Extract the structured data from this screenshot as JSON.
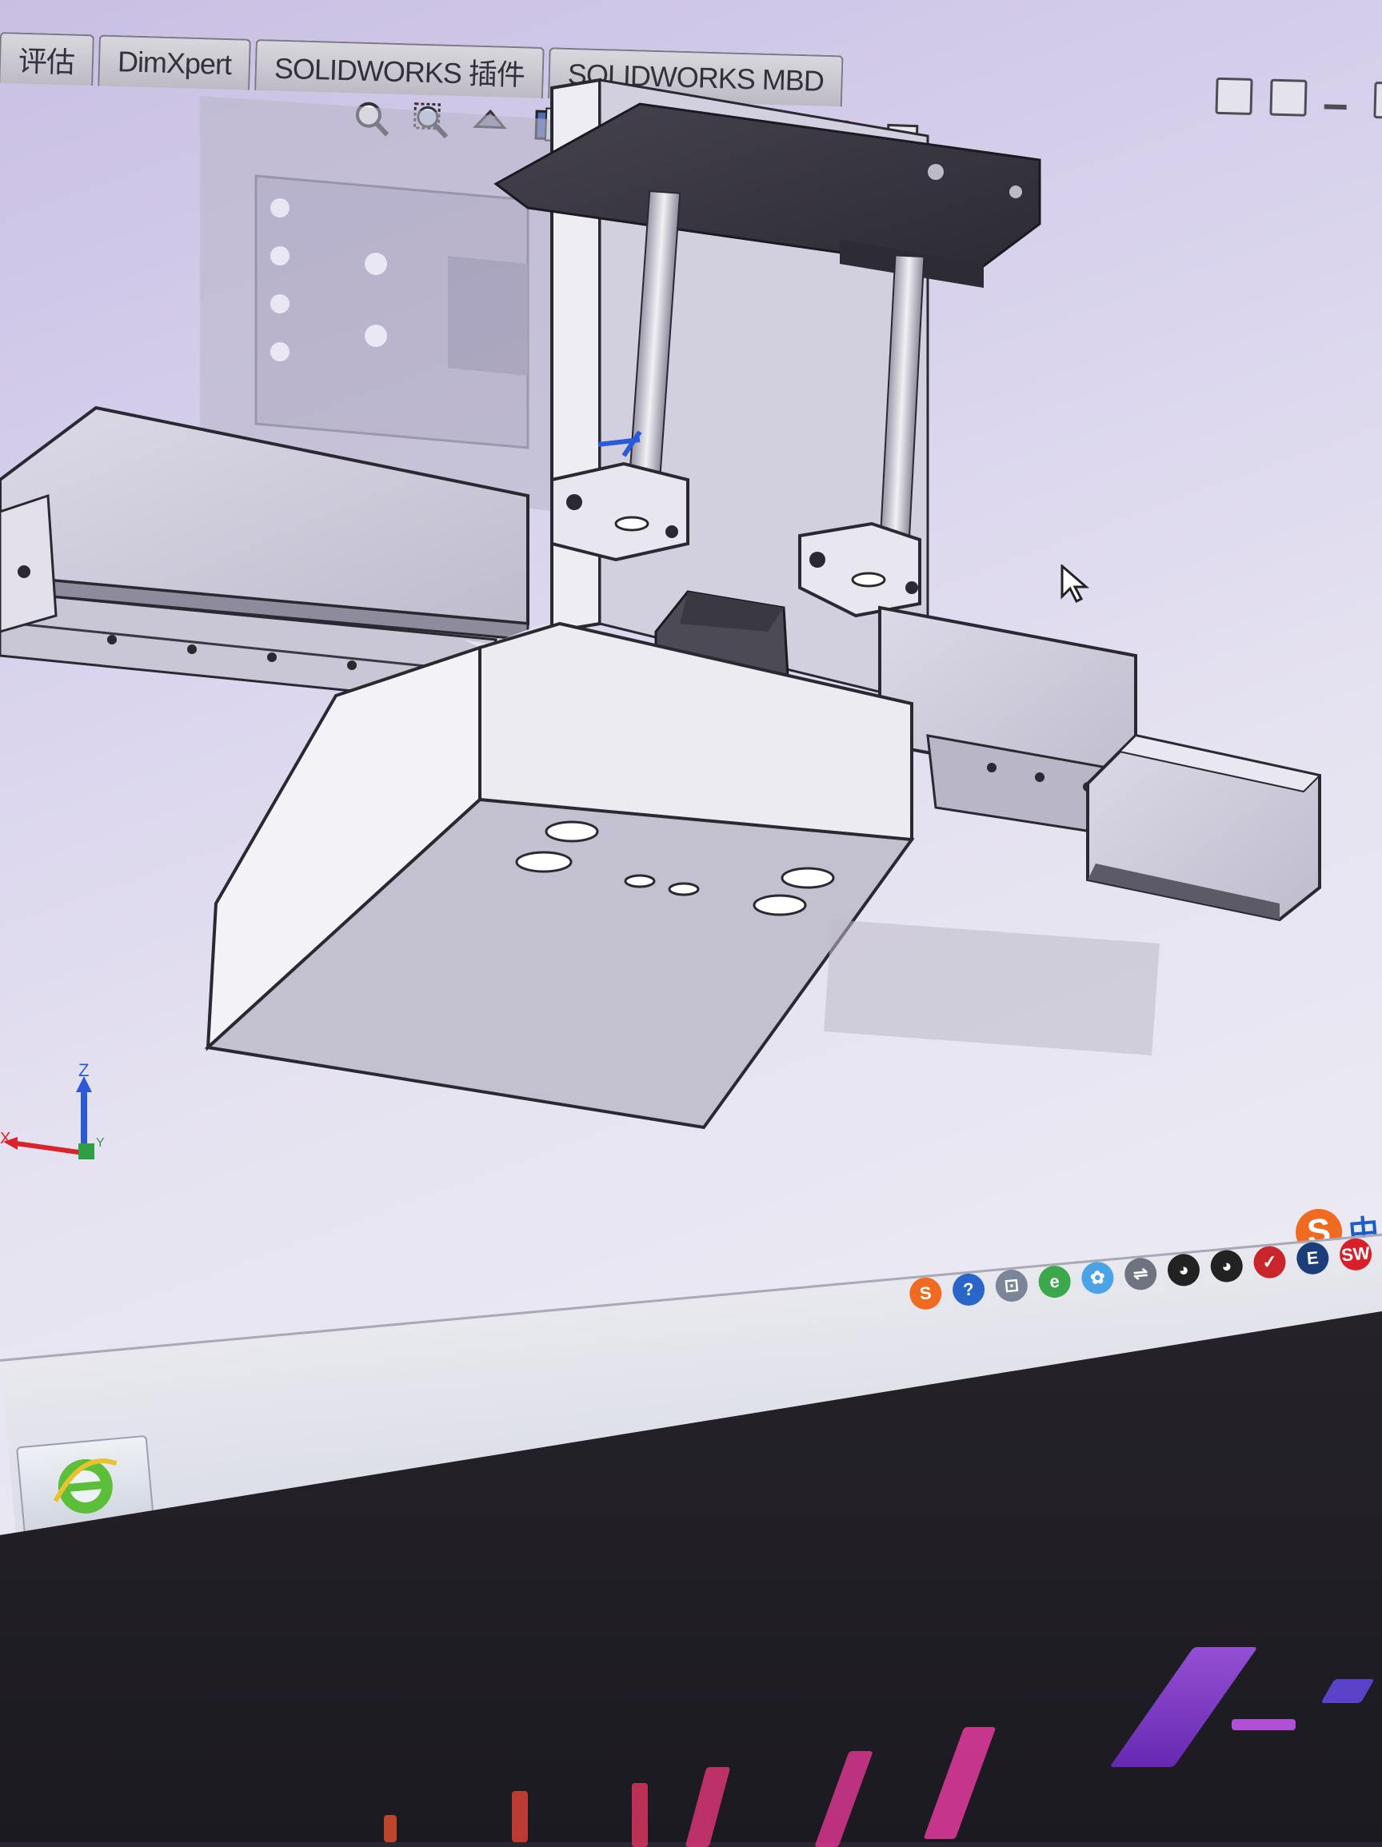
{
  "command_manager": {
    "tabs": [
      {
        "label": "评估"
      },
      {
        "label": "DimXpert"
      },
      {
        "label": "SOLIDWORKS 插件"
      },
      {
        "label": "SOLIDWORKS MBD"
      }
    ]
  },
  "heads_up_toolbar": {
    "icons": [
      "zoom-to-fit-icon",
      "zoom-to-area-icon",
      "previous-view-icon",
      "section-view-icon",
      "view-orientation-icon",
      "display-style-icon",
      "hide-show-items-icon",
      "edit-appearance-icon",
      "apply-scene-icon",
      "view-settings-icon"
    ]
  },
  "window_controls": [
    "restore-pane-icon",
    "split-pane-icon",
    "minimize-icon",
    "restore-icon"
  ],
  "triad": {
    "z_label": "Z",
    "x_label": "X",
    "y_label": "Y"
  },
  "ime": {
    "indicator": "中",
    "logo": "S"
  },
  "taskbar": {
    "tray_icons": [
      {
        "name": "sogou-icon",
        "glyph": "S",
        "color": "#f06a22"
      },
      {
        "name": "help-icon",
        "glyph": "?",
        "color": "#2a66c9"
      },
      {
        "name": "network-icon",
        "glyph": "⊡",
        "color": "#7b8598"
      },
      {
        "name": "ie-icon",
        "glyph": "e",
        "color": "#3aa84b"
      },
      {
        "name": "cloud-app-icon",
        "glyph": "✿",
        "color": "#4aa3e6"
      },
      {
        "name": "usb-icon",
        "glyph": "⇌",
        "color": "#6f7380"
      },
      {
        "name": "qq-icon-1",
        "glyph": "◕",
        "color": "#222"
      },
      {
        "name": "qq-icon-2",
        "glyph": "◕",
        "color": "#222"
      },
      {
        "name": "security-icon",
        "glyph": "✓",
        "color": "#c8262a"
      },
      {
        "name": "ime-bar-icon",
        "glyph": "E",
        "color": "#1d3c7a"
      },
      {
        "name": "solidworks-icon",
        "glyph": "SW",
        "color": "#d8202a"
      }
    ]
  },
  "colors": {
    "viewport_bg": "#e6e3f1",
    "part_face": "#d8d5e3",
    "part_dark": "#3a3840",
    "edge": "#2a2830",
    "accent_blue": "#2a5ad8",
    "axis_red": "#d8242a"
  }
}
